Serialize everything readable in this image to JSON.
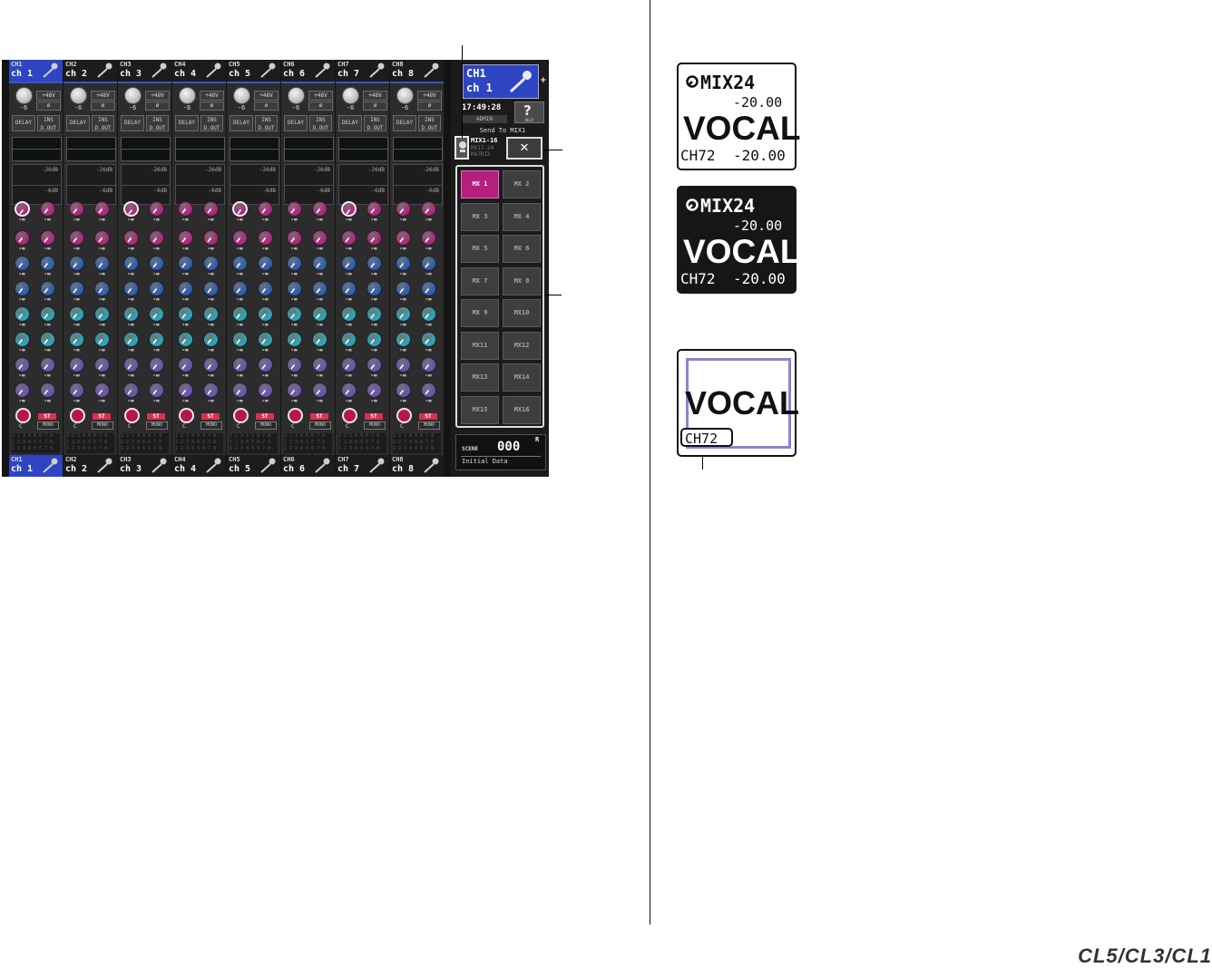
{
  "channels": [
    {
      "id": "CH1",
      "name": "ch 1",
      "selected": true
    },
    {
      "id": "CH2",
      "name": "ch 2",
      "selected": false
    },
    {
      "id": "CH3",
      "name": "ch 3",
      "selected": false
    },
    {
      "id": "CH4",
      "name": "ch 4",
      "selected": false
    },
    {
      "id": "CH5",
      "name": "ch 5",
      "selected": false
    },
    {
      "id": "CH6",
      "name": "ch 6",
      "selected": false
    },
    {
      "id": "CH7",
      "name": "ch 7",
      "selected": false
    },
    {
      "id": "CH8",
      "name": "ch 8",
      "selected": false
    }
  ],
  "strip": {
    "gain": "-6",
    "phantom": "+48V",
    "phase": "ø",
    "delay": "DELAY",
    "ins": "INS",
    "dout": "D.OUT",
    "dyn1": "-26dB",
    "dyn2": "-6dB",
    "send_value": "-∞",
    "pan_value": "C",
    "st": "ST",
    "mono": "MONO",
    "assign_rows": [
      "1 2 3 4 5 6 7 8",
      "1 2 3 4 5 6 7 8",
      "1 2 3 4 5 6 7 8"
    ]
  },
  "panel": {
    "sel_id": "CH1",
    "sel_name": "ch 1",
    "time": "17:49:28",
    "user": "ADMIN",
    "help_label": "HELP",
    "help_glyph": "?",
    "send_to": "Send To MIX1",
    "mix_range": "MIX1-16",
    "mix_alt": "MX17-24",
    "matrix": "MATRIX",
    "close": "✕",
    "mix_buttons": [
      "MX 1",
      "MX 2",
      "MX 3",
      "MX 4",
      "MX 5",
      "MX 6",
      "MX 7",
      "MX 8",
      "MX 9",
      "MX10",
      "MX11",
      "MX12",
      "MX13",
      "MX14",
      "MX15",
      "MX16"
    ],
    "active_mix": 0
  },
  "scene": {
    "label": "SCENE",
    "number": "000",
    "flag": "R",
    "title": "Initial Data"
  },
  "display1": {
    "bus": "MIX24",
    "bus_level": "-20.00",
    "name": "VOCAL",
    "channel": "CH72",
    "channel_level": "-20.00"
  },
  "display2": {
    "bus": "MIX24",
    "bus_level": "-20.00",
    "name": "VOCAL",
    "channel": "CH72",
    "channel_level": "-20.00"
  },
  "display3": {
    "name": "VOCAL",
    "channel": "CH72"
  },
  "logo": "CL5/CL3/CL1",
  "colors": {
    "channel_select": "#2d45c2",
    "mix_on": "#b51f7e",
    "knob_magenta": "#b3247e",
    "knob_blue": "#2b5fb4",
    "knob_cyan": "#2aa7b8",
    "knob_violet": "#6b53b2",
    "pan_red": "#b8154a",
    "frame_purple": "#8b83d0"
  }
}
